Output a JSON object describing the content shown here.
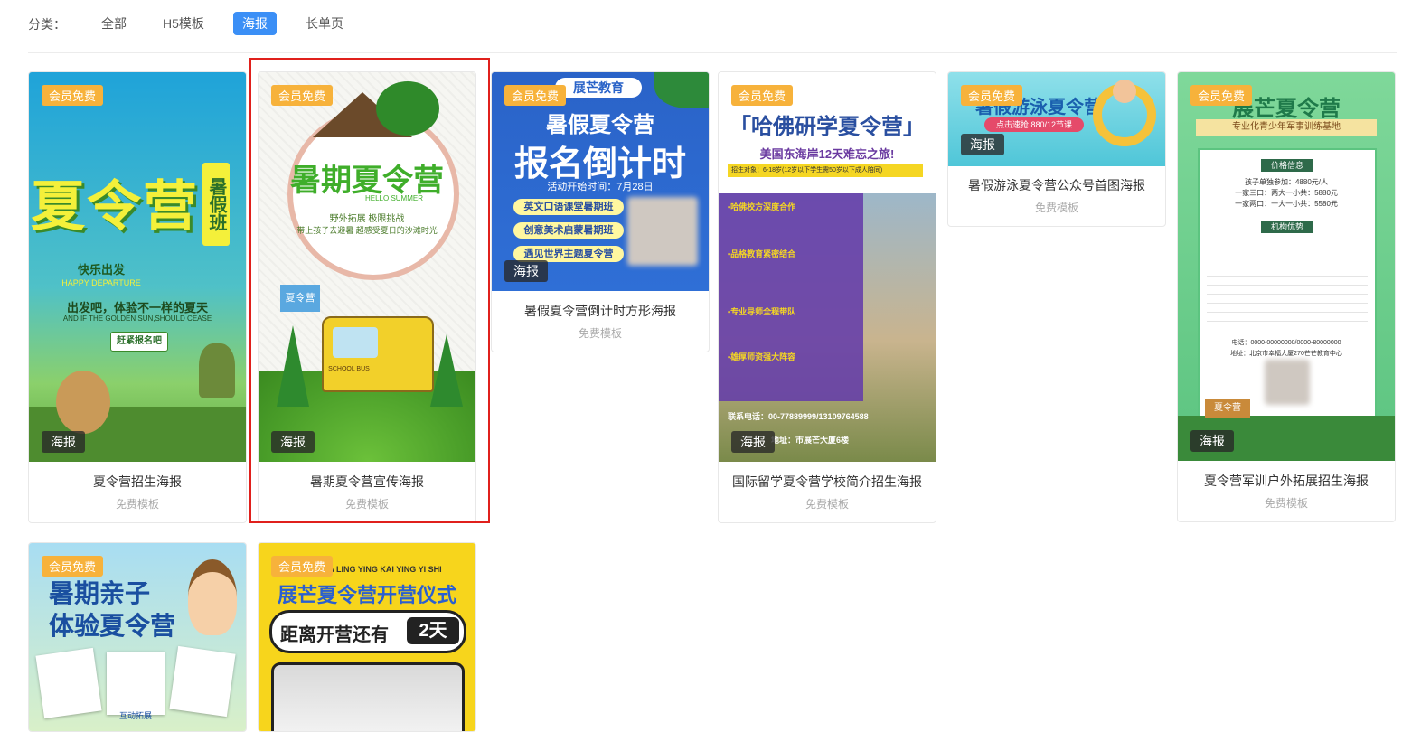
{
  "filter": {
    "label": "分类：",
    "tabs": [
      "全部",
      "H5模板",
      "海报",
      "长单页"
    ],
    "active_index": 2
  },
  "colors": {
    "accent": "#3b8ff6",
    "member_badge": "#f7b23b",
    "highlight": "#e0201c"
  },
  "cards": [
    {
      "member_badge": "会员免费",
      "type_badge": "海报",
      "title": "夏令营招生海报",
      "subtitle": "免费模板",
      "poster": {
        "main": "夏令营",
        "side": "暑假班",
        "tag": "快乐出发",
        "line1": "出发吧，体验不一样的夏天",
        "line2": "AND IF THE GOLDEN SUN,SHOULD CEASE",
        "button": "赶紧报名吧",
        "en": "HAPPY DEPARTURE"
      }
    },
    {
      "member_badge": "会员免费",
      "type_badge": "海报",
      "title": "暑期夏令营宣传海报",
      "subtitle": "免费模板",
      "poster": {
        "main": "暑期夏令营",
        "en": "HELLO SUMMER",
        "line1": "野外拓展 极限挑战",
        "line2": "带上孩子去避暑 超感受夏日的沙滩时光",
        "flag": "夏令营",
        "bus": "SCHOOL BUS"
      }
    },
    {
      "member_badge": "会员免费",
      "type_badge": "海报",
      "title": "暑假夏令营倒计时方形海报",
      "subtitle": "免费模板",
      "poster": {
        "brand": "展芒教育",
        "line1": "暑假夏令营",
        "line2": "报名倒计时",
        "date": "活动开始时间：7月28日",
        "items": [
          "英文口语课堂暑期班",
          "创意美术启蒙暑期班",
          "遇见世界主题夏令营"
        ]
      }
    },
    {
      "member_badge": "会员免费",
      "type_badge": "海报",
      "title": "国际留学夏令营学校简介招生海报",
      "subtitle": "免费模板",
      "poster": {
        "main": "「哈佛研学夏令营」",
        "sub": "美国东海岸12天难忘之旅!",
        "target": "招生对象：6-18岁(12岁以下学生需50岁以下成人陪同)",
        "points": [
          "•哈佛校方深度合作",
          "•品格教育紧密结合",
          "•专业导师全程带队",
          "•雄厚师资强大阵容"
        ],
        "contact": "联系电话：00-77889999/13109764588",
        "addr": "地址：市展芒大厦6楼"
      }
    },
    {
      "member_badge": "会员免费",
      "type_badge": "海报",
      "title": "暑假游泳夏令营公众号首图海报",
      "subtitle": "免费模板",
      "poster": {
        "main": "暑假游泳夏令营",
        "sub": "点击速抢 880/12节课"
      }
    },
    {
      "member_badge": "会员免费",
      "type_badge": "海报",
      "title": "夏令营军训户外拓展招生海报",
      "subtitle": "免费模板",
      "poster": {
        "main": "展芒夏令营",
        "banner": "专业化青少年军事训练基地",
        "price_head": "价格信息",
        "prices": [
          "孩子单独参加：4880元/人",
          "一家三口：两大一小共：5880元",
          "一家两口：一大一小共：5580元"
        ],
        "adv_head": "机构优势",
        "phone": "电话：0000-00000000/0000-80000000",
        "addr": "地址：北京市幸福大厦270芒芒教育中心",
        "sign": "夏令营"
      }
    },
    {
      "member_badge": "会员免费",
      "type_badge": "",
      "title": "",
      "subtitle": "",
      "poster": {
        "line1": "暑期亲子",
        "line2": "体验夏令营",
        "caption": "互动拓展"
      }
    },
    {
      "member_badge": "会员免费",
      "type_badge": "",
      "title": "",
      "subtitle": "",
      "poster": {
        "top": "A LING YING KAI YING YI SHI",
        "main": "展芒夏令营开营仪式",
        "countdown": "距离开营还有",
        "days": "2天"
      }
    }
  ]
}
